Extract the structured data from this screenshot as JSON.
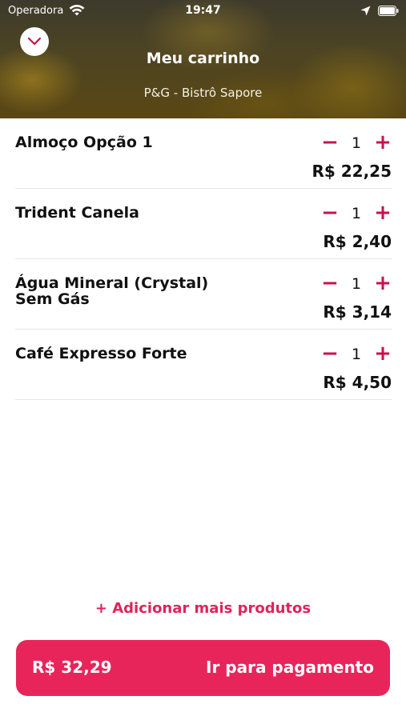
{
  "status_bar": {
    "carrier": "Operadora",
    "time": "19:47"
  },
  "header": {
    "title": "Meu carrinho",
    "subtitle": "P&G - Bistrô Sapore"
  },
  "items": [
    {
      "name": "Almoço Opção 1",
      "quantity": "1",
      "price": "R$ 22,25"
    },
    {
      "name": "Trident Canela",
      "quantity": "1",
      "price": "R$ 2,40"
    },
    {
      "name": "Água Mineral (Crystal) Sem Gás",
      "quantity": "1",
      "price": "R$ 3,14"
    },
    {
      "name": "Café Expresso Forte",
      "quantity": "1",
      "price": "R$ 4,50"
    }
  ],
  "qty_controls": {
    "minus": "−",
    "plus": "+"
  },
  "add_more_label": "+ Adicionar mais produtos",
  "checkout": {
    "total": "R$ 32,29",
    "label": "Ir para pagamento"
  },
  "colors": {
    "accent": "#e8255b",
    "stepper": "#c8124c"
  }
}
